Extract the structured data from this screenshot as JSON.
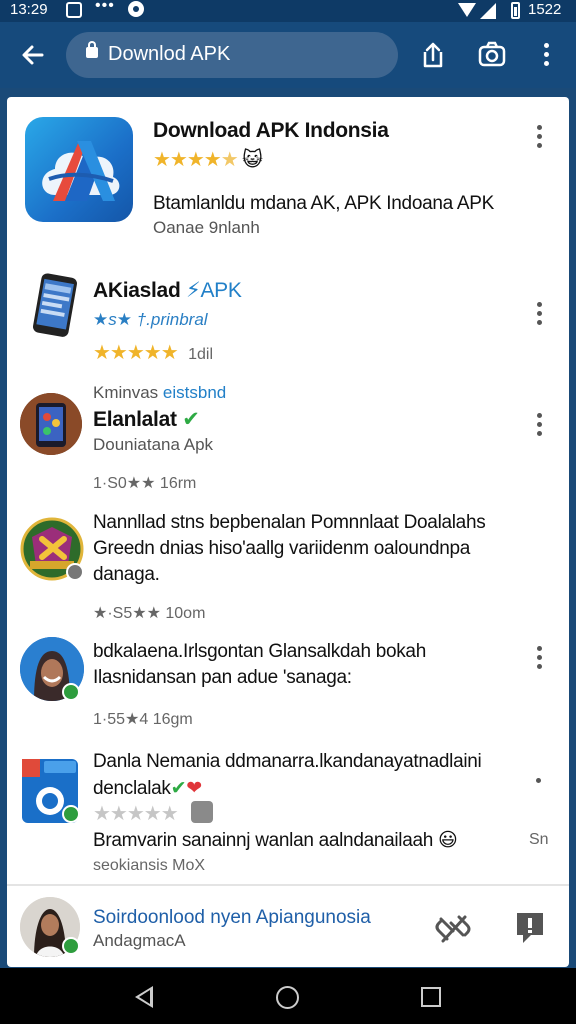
{
  "status_bar": {
    "time": "13:29",
    "right_time": "1522"
  },
  "toolbar": {
    "url_text": "Downlod APK"
  },
  "items": [
    {
      "title": "Download APK Indonsia",
      "stars": "★★★★",
      "half": "★",
      "emoji": "😺",
      "description": "Btamlanldu mdana AK, APK Indoana APK",
      "subtitle": "Oanae 9nlanh"
    },
    {
      "title": "AKiaslad",
      "title_accent": "⚡APK",
      "tagline": "★s★ †.prinbral",
      "stars": "★★★★",
      "stars_off": "★",
      "rating_count": "1dil"
    },
    {
      "category": "Kminvas",
      "category_accent": "eistsbnd",
      "title": "Elanlalat",
      "check": "✔",
      "subtitle": "Douniatana Apk",
      "meta": "1·S0★★ 16rm"
    },
    {
      "line1": "Nannllad stns bepbenalan Pomnnlaat Doalalahs",
      "line2": "Greedn dnias hiso'aallg variidenm oaloundnpa",
      "line3": "danaga.",
      "meta": "★·S5★★ 10om"
    },
    {
      "line1": "bdkalaena.Irlsgontan Glansalkdah bokah",
      "line2": "Ilasnidansan pan adue 'sanaga:",
      "meta": "1·55★4 16gm"
    },
    {
      "line1": "Danla Nemania ddmanarra.lkandanayatnadlaini",
      "line2": "denclalak",
      "check": "✔",
      "heart": "❤",
      "gray_stars": "★★★★★",
      "description": "Bramvarin sanainnj wanlan aalndanailaah",
      "emoji": "😃",
      "meta": "seokiansis MoX",
      "right_meta": "Sn"
    }
  ],
  "bottom_item": {
    "title": "Soirdoonlood nyen Apiangunosia",
    "subtitle": "AndagmacA"
  }
}
